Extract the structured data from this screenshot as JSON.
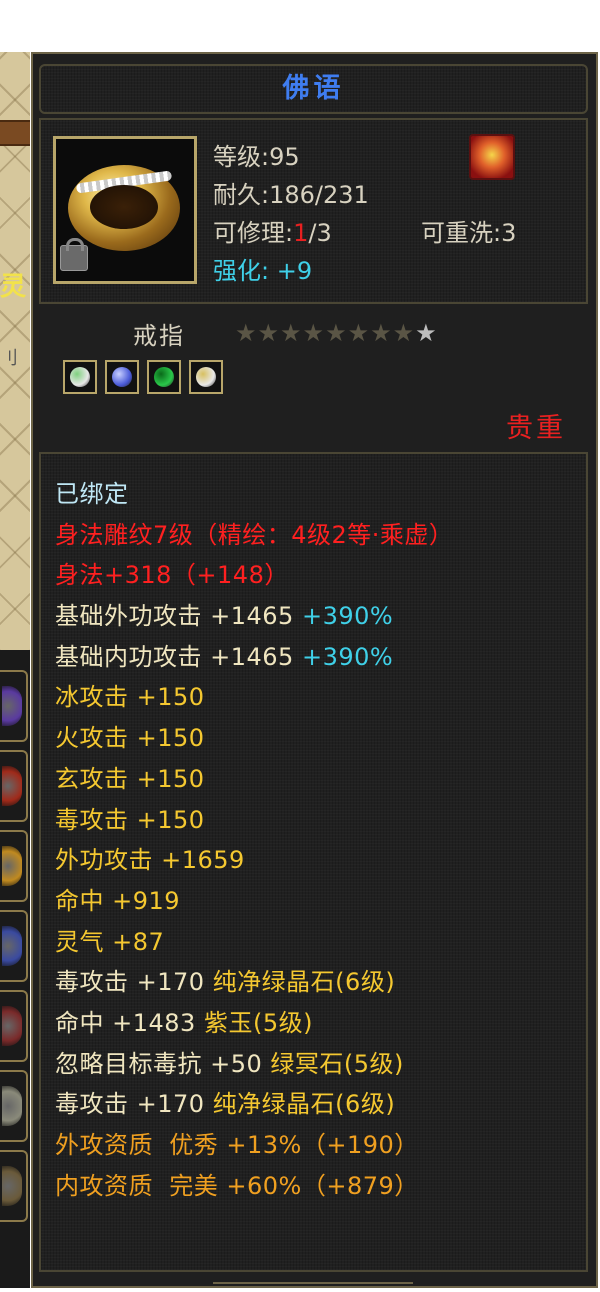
{
  "left_background": {
    "fragment_text": "灵",
    "fragment_text_2": "刂",
    "slot_colors": [
      "#5a3aa0",
      "#a02a1a",
      "#c08a20",
      "#3a4aa0",
      "#7a2a2a",
      "#8a8a7a",
      "#6a5a3a"
    ]
  },
  "tooltip": {
    "title": "佛语",
    "icon": "gold-ring-icon",
    "level": {
      "label": "等级:",
      "value": "95"
    },
    "durability": {
      "label": "耐久:",
      "value": "186/231"
    },
    "repair": {
      "label": "可修理:",
      "current": "1",
      "max": "/3"
    },
    "rewash": {
      "label": "可重洗:",
      "value": "3"
    },
    "enhance": {
      "label": "强化: ",
      "value": "+9"
    },
    "item_type": "戒指",
    "stars_total": 9,
    "stars_lit": 1,
    "gems": [
      {
        "name": "white-gem-icon",
        "color": "#e8e8e8",
        "accent": "#7fd07f"
      },
      {
        "name": "blue-gem-icon",
        "color": "#4a5ad8",
        "accent": "#c8d0ff"
      },
      {
        "name": "green-gem-icon",
        "color": "#2ac84a",
        "accent": "#0a6a1a"
      },
      {
        "name": "white-gem-icon",
        "color": "#e8e8e8",
        "accent": "#d8c060"
      }
    ],
    "rarity": "贵重",
    "attributes": [
      {
        "segments": [
          {
            "text": "已绑定",
            "color": "#bfe7f5"
          }
        ]
      },
      {
        "segments": [
          {
            "text": "身法雕纹7级（精绘：4级2等·乘虚）",
            "color": "#ff2020"
          }
        ]
      },
      {
        "segments": [
          {
            "text": "身法+318（+148）",
            "color": "#ff2020"
          }
        ]
      },
      {
        "segments": [
          {
            "text": "基础外功攻击 +1465 ",
            "color": "#f0e6c0"
          },
          {
            "text": "+390%",
            "color": "#3fd0e8"
          }
        ]
      },
      {
        "segments": [
          {
            "text": "基础内功攻击 +1465 ",
            "color": "#f0e6c0"
          },
          {
            "text": "+390%",
            "color": "#3fd0e8"
          }
        ]
      },
      {
        "segments": [
          {
            "text": "冰攻击 +150",
            "color": "#f5c830"
          }
        ]
      },
      {
        "segments": [
          {
            "text": "火攻击 +150",
            "color": "#f5c830"
          }
        ]
      },
      {
        "segments": [
          {
            "text": "玄攻击 +150",
            "color": "#f5c830"
          }
        ]
      },
      {
        "segments": [
          {
            "text": "毒攻击 +150",
            "color": "#f5c830"
          }
        ]
      },
      {
        "segments": [
          {
            "text": "外功攻击 +1659",
            "color": "#f5c830"
          }
        ]
      },
      {
        "segments": [
          {
            "text": "命中 +919",
            "color": "#f5c830"
          }
        ]
      },
      {
        "segments": [
          {
            "text": "灵气 +87",
            "color": "#f5c830"
          }
        ]
      },
      {
        "segments": [
          {
            "text": "毒攻击 +170 ",
            "color": "#f0e6c0"
          },
          {
            "text": "纯净绿晶石(6级)",
            "color": "#f5c830"
          }
        ]
      },
      {
        "segments": [
          {
            "text": "命中 +1483 ",
            "color": "#f0e6c0"
          },
          {
            "text": "紫玉(5级)",
            "color": "#f5c830"
          }
        ]
      },
      {
        "segments": [
          {
            "text": "忽略目标毒抗 +50 ",
            "color": "#f0e6c0"
          },
          {
            "text": "绿冥石(5级)",
            "color": "#f5c830"
          }
        ]
      },
      {
        "segments": [
          {
            "text": "毒攻击 +170 ",
            "color": "#f0e6c0"
          },
          {
            "text": "纯净绿晶石(6级)",
            "color": "#f5c830"
          }
        ]
      },
      {
        "segments": [
          {
            "text": "外攻资质  优秀 +13%（+190）",
            "color": "#f0a020"
          }
        ]
      },
      {
        "segments": [
          {
            "text": "内攻资质  完美 +60%（+879）",
            "color": "#f0a020"
          }
        ]
      }
    ]
  }
}
